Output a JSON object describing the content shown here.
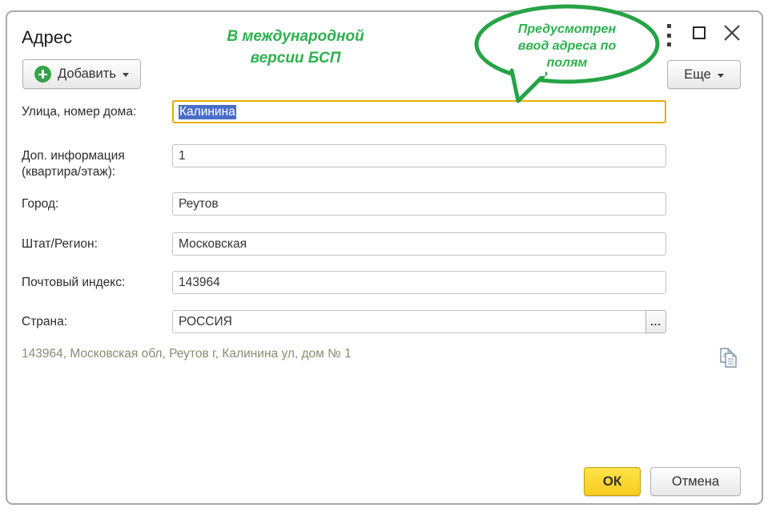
{
  "window": {
    "title": "Адрес",
    "menu_icon": "kebab-menu",
    "maximize_icon": "maximize-square",
    "close_icon": "close-x"
  },
  "annotations": {
    "note_lines": [
      "В международной",
      "версии БСП"
    ],
    "bubble_lines": [
      "Предусмотрен",
      "ввод адреса по",
      "полям"
    ]
  },
  "toolbar": {
    "add_label": "Добавить",
    "more_label": "Еще"
  },
  "form": {
    "fields": [
      {
        "label": "Улица, номер дома:",
        "value": "Калинина"
      },
      {
        "label": "Доп. информация (квартира/этаж):",
        "value": "1"
      },
      {
        "label": "Город:",
        "value": "Реутов"
      },
      {
        "label": "Штат/Регион:",
        "value": "Московская"
      },
      {
        "label": "Почтовый индекс:",
        "value": "143964"
      },
      {
        "label": "Страна:",
        "value": "РОССИЯ"
      }
    ],
    "picker_label": "...",
    "summary": "143964, Московская обл, Реутов г, Калинина ул, дом № 1",
    "copy_icon": "copy-pages"
  },
  "footer": {
    "ok_label": "ОК",
    "cancel_label": "Отмена"
  },
  "colors": {
    "annotation_green": "#2db14f",
    "bubble_border_green": "#26a346",
    "focus_border_yellow": "#e8ac08",
    "selection_blue": "#4a6ec8",
    "ok_button_yellow": "#f9d420",
    "summary_text": "#8c8b74",
    "add_icon_green": "#34a349"
  }
}
